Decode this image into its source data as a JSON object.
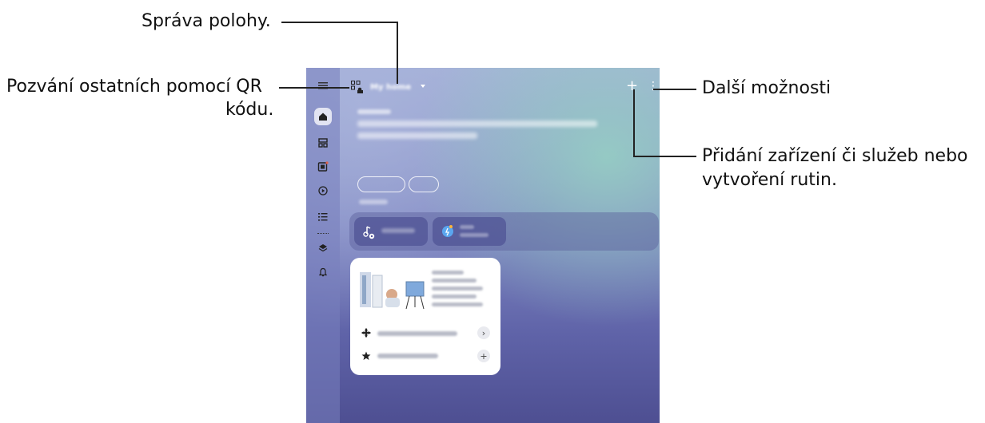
{
  "callouts": {
    "location": "Správa polohy.",
    "invite_line1": "Pozvání ostatních pomocí QR",
    "invite_line2": "kódu.",
    "more": "Další možnosti",
    "add_line1": "Přidání zařízení či služeb nebo",
    "add_line2": "vytvoření rutin."
  },
  "app": {
    "home_name": "My home",
    "add_symbol": "+",
    "more_symbol": "⋮",
    "rail_icons": [
      "menu-icon",
      "home-icon",
      "devices-icon",
      "life-icon",
      "routines-icon",
      "list-icon",
      "layers-icon",
      "notifications-icon"
    ]
  },
  "colors": {
    "screen_top": "#a2b0d6",
    "screen_bottom": "#4e4f92",
    "accent_teal": "#96d2c3",
    "card_bg": "#ffffff"
  }
}
